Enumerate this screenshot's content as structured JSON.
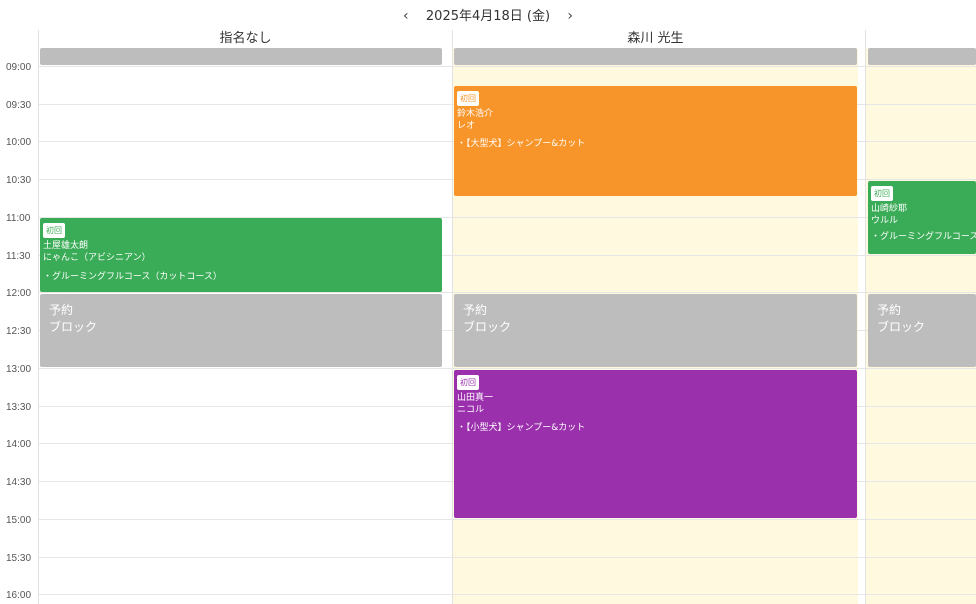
{
  "header": {
    "date": "2025年4月18日 (金)",
    "prev_icon": "chevron-left-icon",
    "next_icon": "chevron-right-icon",
    "prev_glyph": "‹",
    "next_glyph": "›"
  },
  "columns": [
    {
      "name": "指名なし"
    },
    {
      "name": "森川 光生"
    },
    {
      "name": ""
    }
  ],
  "times": [
    "09:00",
    "09:30",
    "10:00",
    "10:30",
    "11:00",
    "11:30",
    "12:00",
    "12:30",
    "13:00",
    "13:30",
    "14:00",
    "14:30",
    "15:00",
    "15:30",
    "16:00"
  ],
  "appointments": {
    "green_left": {
      "badge": "初回",
      "customer": "土屋雄太朗",
      "pet": "にゃんこ（アビシニアン）",
      "service": "・グルーミングフルコース（カットコース）",
      "color": "#3aab56"
    },
    "orange": {
      "badge": "初回",
      "customer": "鈴木浩介",
      "pet": "レオ",
      "service": "・【大型犬】シャンプー&カット",
      "color": "#f7952a"
    },
    "green_right": {
      "badge": "初回",
      "customer": "山崎紗耶",
      "pet": "ウルル",
      "service": "・グルーミングフルコース",
      "color": "#3aab56"
    },
    "purple": {
      "badge": "初回",
      "customer": "山田真一",
      "pet": "ニコル",
      "service": "・【小型犬】シャンプー&カット",
      "color": "#9b30ad"
    }
  },
  "blocks": {
    "line1": "予約",
    "line2": "ブロック"
  },
  "colors": {
    "cream": "#fff9e0",
    "block_gray": "#bdbdbd"
  }
}
